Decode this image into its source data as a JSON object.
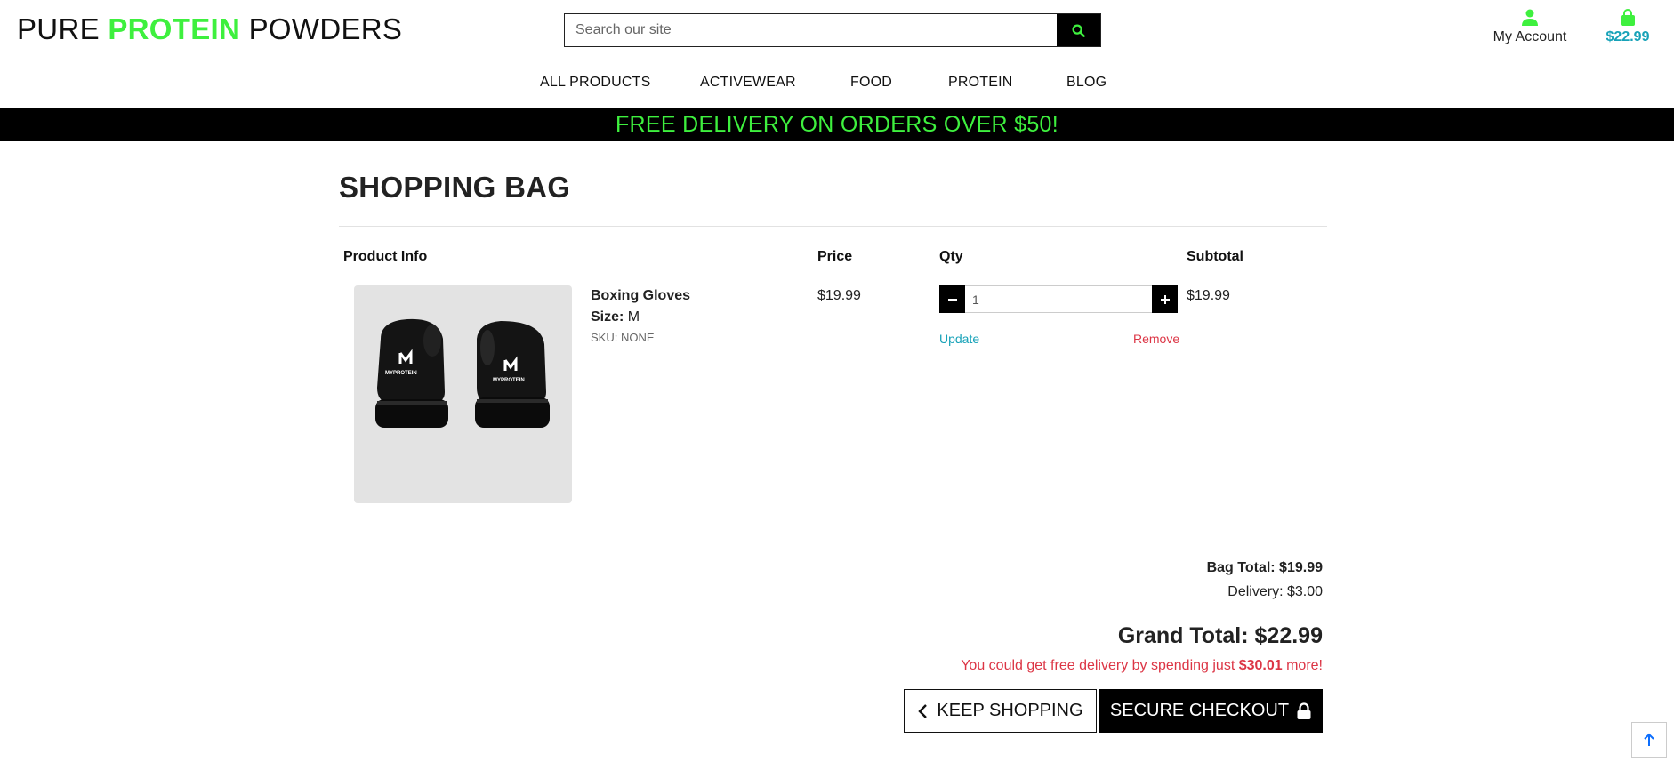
{
  "header": {
    "logo_part1": "PURE ",
    "logo_part2": "PROTEIN",
    "logo_part3": " POWDERS",
    "search_placeholder": "Search our site",
    "account_label": "My Account",
    "cart_total": "$22.99"
  },
  "nav": {
    "items": [
      "ALL PRODUCTS",
      "ACTIVEWEAR",
      "FOOD",
      "PROTEIN",
      "BLOG"
    ]
  },
  "banner": "FREE DELIVERY ON ORDERS OVER $50!",
  "page_title": "SHOPPING BAG",
  "table": {
    "headers": [
      "Product Info",
      "Price",
      "Qty",
      "Subtotal"
    ]
  },
  "item": {
    "name": "Boxing Gloves",
    "size_label": "Size:",
    "size_value": "M",
    "sku": "SKU: NONE",
    "price": "$19.99",
    "qty": "1",
    "subtotal": "$19.99",
    "update_label": "Update",
    "remove_label": "Remove",
    "brand_text": "MYPROTEIN"
  },
  "totals": {
    "bag_total": "Bag Total: $19.99",
    "delivery": "Delivery: $3.00",
    "grand_total": "Grand Total: $22.99",
    "free_msg_prefix": "You could get free delivery by spending just ",
    "free_msg_amount": "$30.01",
    "free_msg_suffix": " more!"
  },
  "buttons": {
    "keep_shopping": "KEEP SHOPPING",
    "secure_checkout": "SECURE CHECKOUT"
  },
  "colors": {
    "brand_green": "#3ef03e",
    "link_teal": "#17a2b8",
    "danger_red": "#dc3545"
  },
  "icons": [
    "search-icon",
    "user-icon",
    "shopping-bag-icon",
    "minus-icon",
    "plus-icon",
    "chevron-left-icon",
    "lock-icon",
    "arrow-up-icon"
  ]
}
